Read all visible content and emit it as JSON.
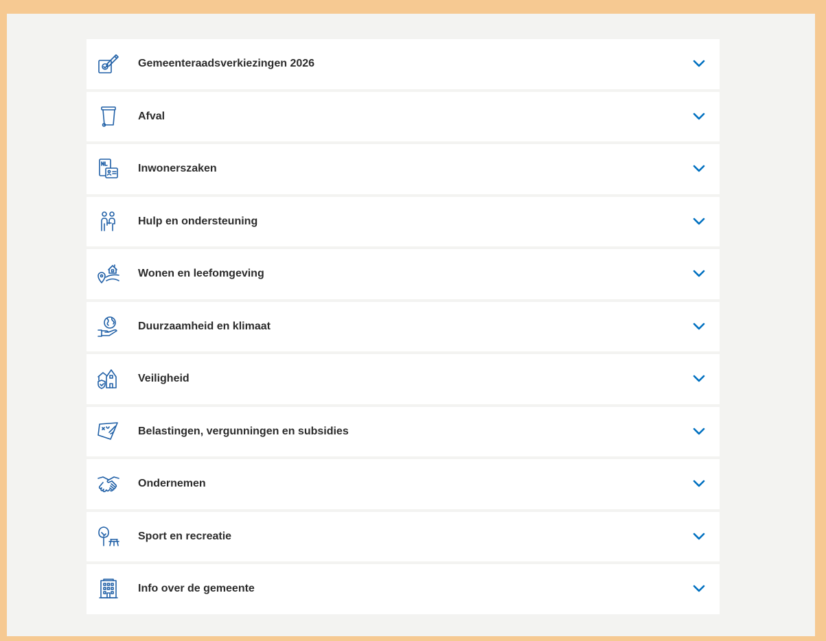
{
  "colors": {
    "frame": "#f6c992",
    "background": "#f3f3f1",
    "card": "#ffffff",
    "icon_blue": "#1f5fa6",
    "chevron_blue": "#0070c0",
    "text": "#2b2b2b"
  },
  "accordion": {
    "items": [
      {
        "label": "Gemeenteraadsverkiezingen 2026",
        "icon": "ballot-vote-icon"
      },
      {
        "label": "Afval",
        "icon": "waste-bin-icon"
      },
      {
        "label": "Inwonerszaken",
        "icon": "id-card-icon"
      },
      {
        "label": "Hulp en ondersteuning",
        "icon": "people-support-icon"
      },
      {
        "label": "Wonen en leefomgeving",
        "icon": "house-location-icon"
      },
      {
        "label": "Duurzaamheid en klimaat",
        "icon": "globe-hand-icon"
      },
      {
        "label": "Veiligheid",
        "icon": "shield-town-icon"
      },
      {
        "label": "Belastingen, vergunningen en subsidies",
        "icon": "document-pen-icon"
      },
      {
        "label": "Ondernemen",
        "icon": "handshake-icon"
      },
      {
        "label": "Sport en recreatie",
        "icon": "tree-bench-icon"
      },
      {
        "label": "Info over de gemeente",
        "icon": "municipal-building-icon"
      }
    ]
  }
}
